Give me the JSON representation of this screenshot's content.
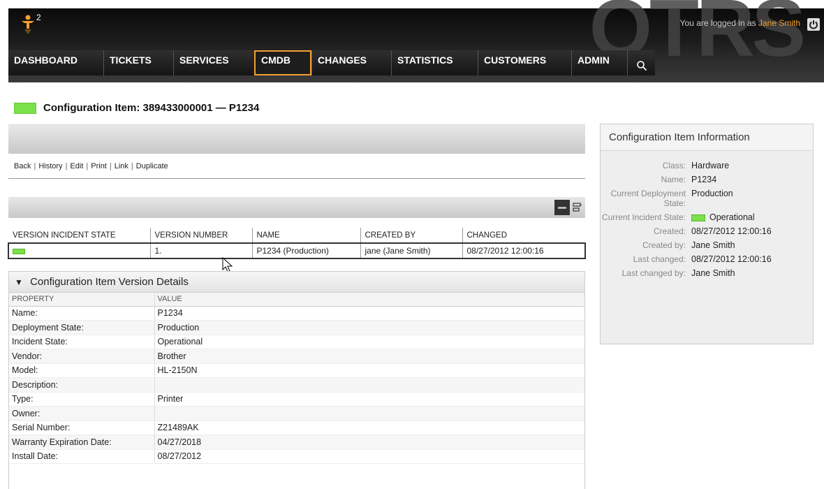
{
  "header": {
    "notify_count": "2",
    "watermark": "OTRS",
    "login_prefix": "You are logged in as",
    "login_user": "Jane Smith"
  },
  "nav": {
    "items": [
      {
        "label": "DASHBOARD",
        "width": 136
      },
      {
        "label": "TICKETS",
        "width": 100
      },
      {
        "label": "SERVICES",
        "width": 116
      },
      {
        "label": "CMDB",
        "width": 82
      },
      {
        "label": "CHANGES",
        "width": 114
      },
      {
        "label": "STATISTICS",
        "width": 124
      },
      {
        "label": "CUSTOMERS",
        "width": 134
      },
      {
        "label": "ADMIN",
        "width": 80
      }
    ],
    "active": "CMDB"
  },
  "page": {
    "title": "Configuration Item: 389433000001 — P1234",
    "title_color": "#7be14a"
  },
  "actions": [
    "Back",
    "History",
    "Edit",
    "Print",
    "Link",
    "Duplicate"
  ],
  "version_table": {
    "headers": [
      "VERSION INCIDENT STATE",
      "VERSION NUMBER",
      "NAME",
      "CREATED BY",
      "CHANGED"
    ],
    "row": {
      "incident_color": "#7be14a",
      "version": "1.",
      "name": "P1234 (Production)",
      "created_by": "jane (Jane Smith)",
      "changed": "08/27/2012 12:00:16"
    }
  },
  "details": {
    "title": "Configuration Item Version Details",
    "col_property": "PROPERTY",
    "col_value": "VALUE",
    "rows": [
      {
        "property": "Name:",
        "value": "P1234"
      },
      {
        "property": "Deployment State:",
        "value": "Production"
      },
      {
        "property": "Incident State:",
        "value": "Operational"
      },
      {
        "property": "Vendor:",
        "value": "Brother"
      },
      {
        "property": "Model:",
        "value": "HL-2150N"
      },
      {
        "property": "Description:",
        "value": ""
      },
      {
        "property": "Type:",
        "value": "Printer"
      },
      {
        "property": "Owner:",
        "value": ""
      },
      {
        "property": "Serial Number:",
        "value": "Z21489AK"
      },
      {
        "property": "Warranty Expiration Date:",
        "value": "04/27/2018"
      },
      {
        "property": "Install Date:",
        "value": "08/27/2012"
      }
    ]
  },
  "sidebar": {
    "title": "Configuration Item Information",
    "rows": [
      {
        "label": "Class:",
        "value": "Hardware"
      },
      {
        "label": "Name:",
        "value": "P1234"
      },
      {
        "label": "Current Deployment State:",
        "value": "Production"
      },
      {
        "label": "Current Incident State:",
        "value": "Operational",
        "swatch": "#7be14a"
      },
      {
        "label": "Created:",
        "value": "08/27/2012 12:00:16"
      },
      {
        "label": "Created by:",
        "value": "Jane Smith"
      },
      {
        "label": "Last changed:",
        "value": "08/27/2012 12:00:16"
      },
      {
        "label": "Last changed by:",
        "value": "Jane Smith"
      }
    ]
  }
}
